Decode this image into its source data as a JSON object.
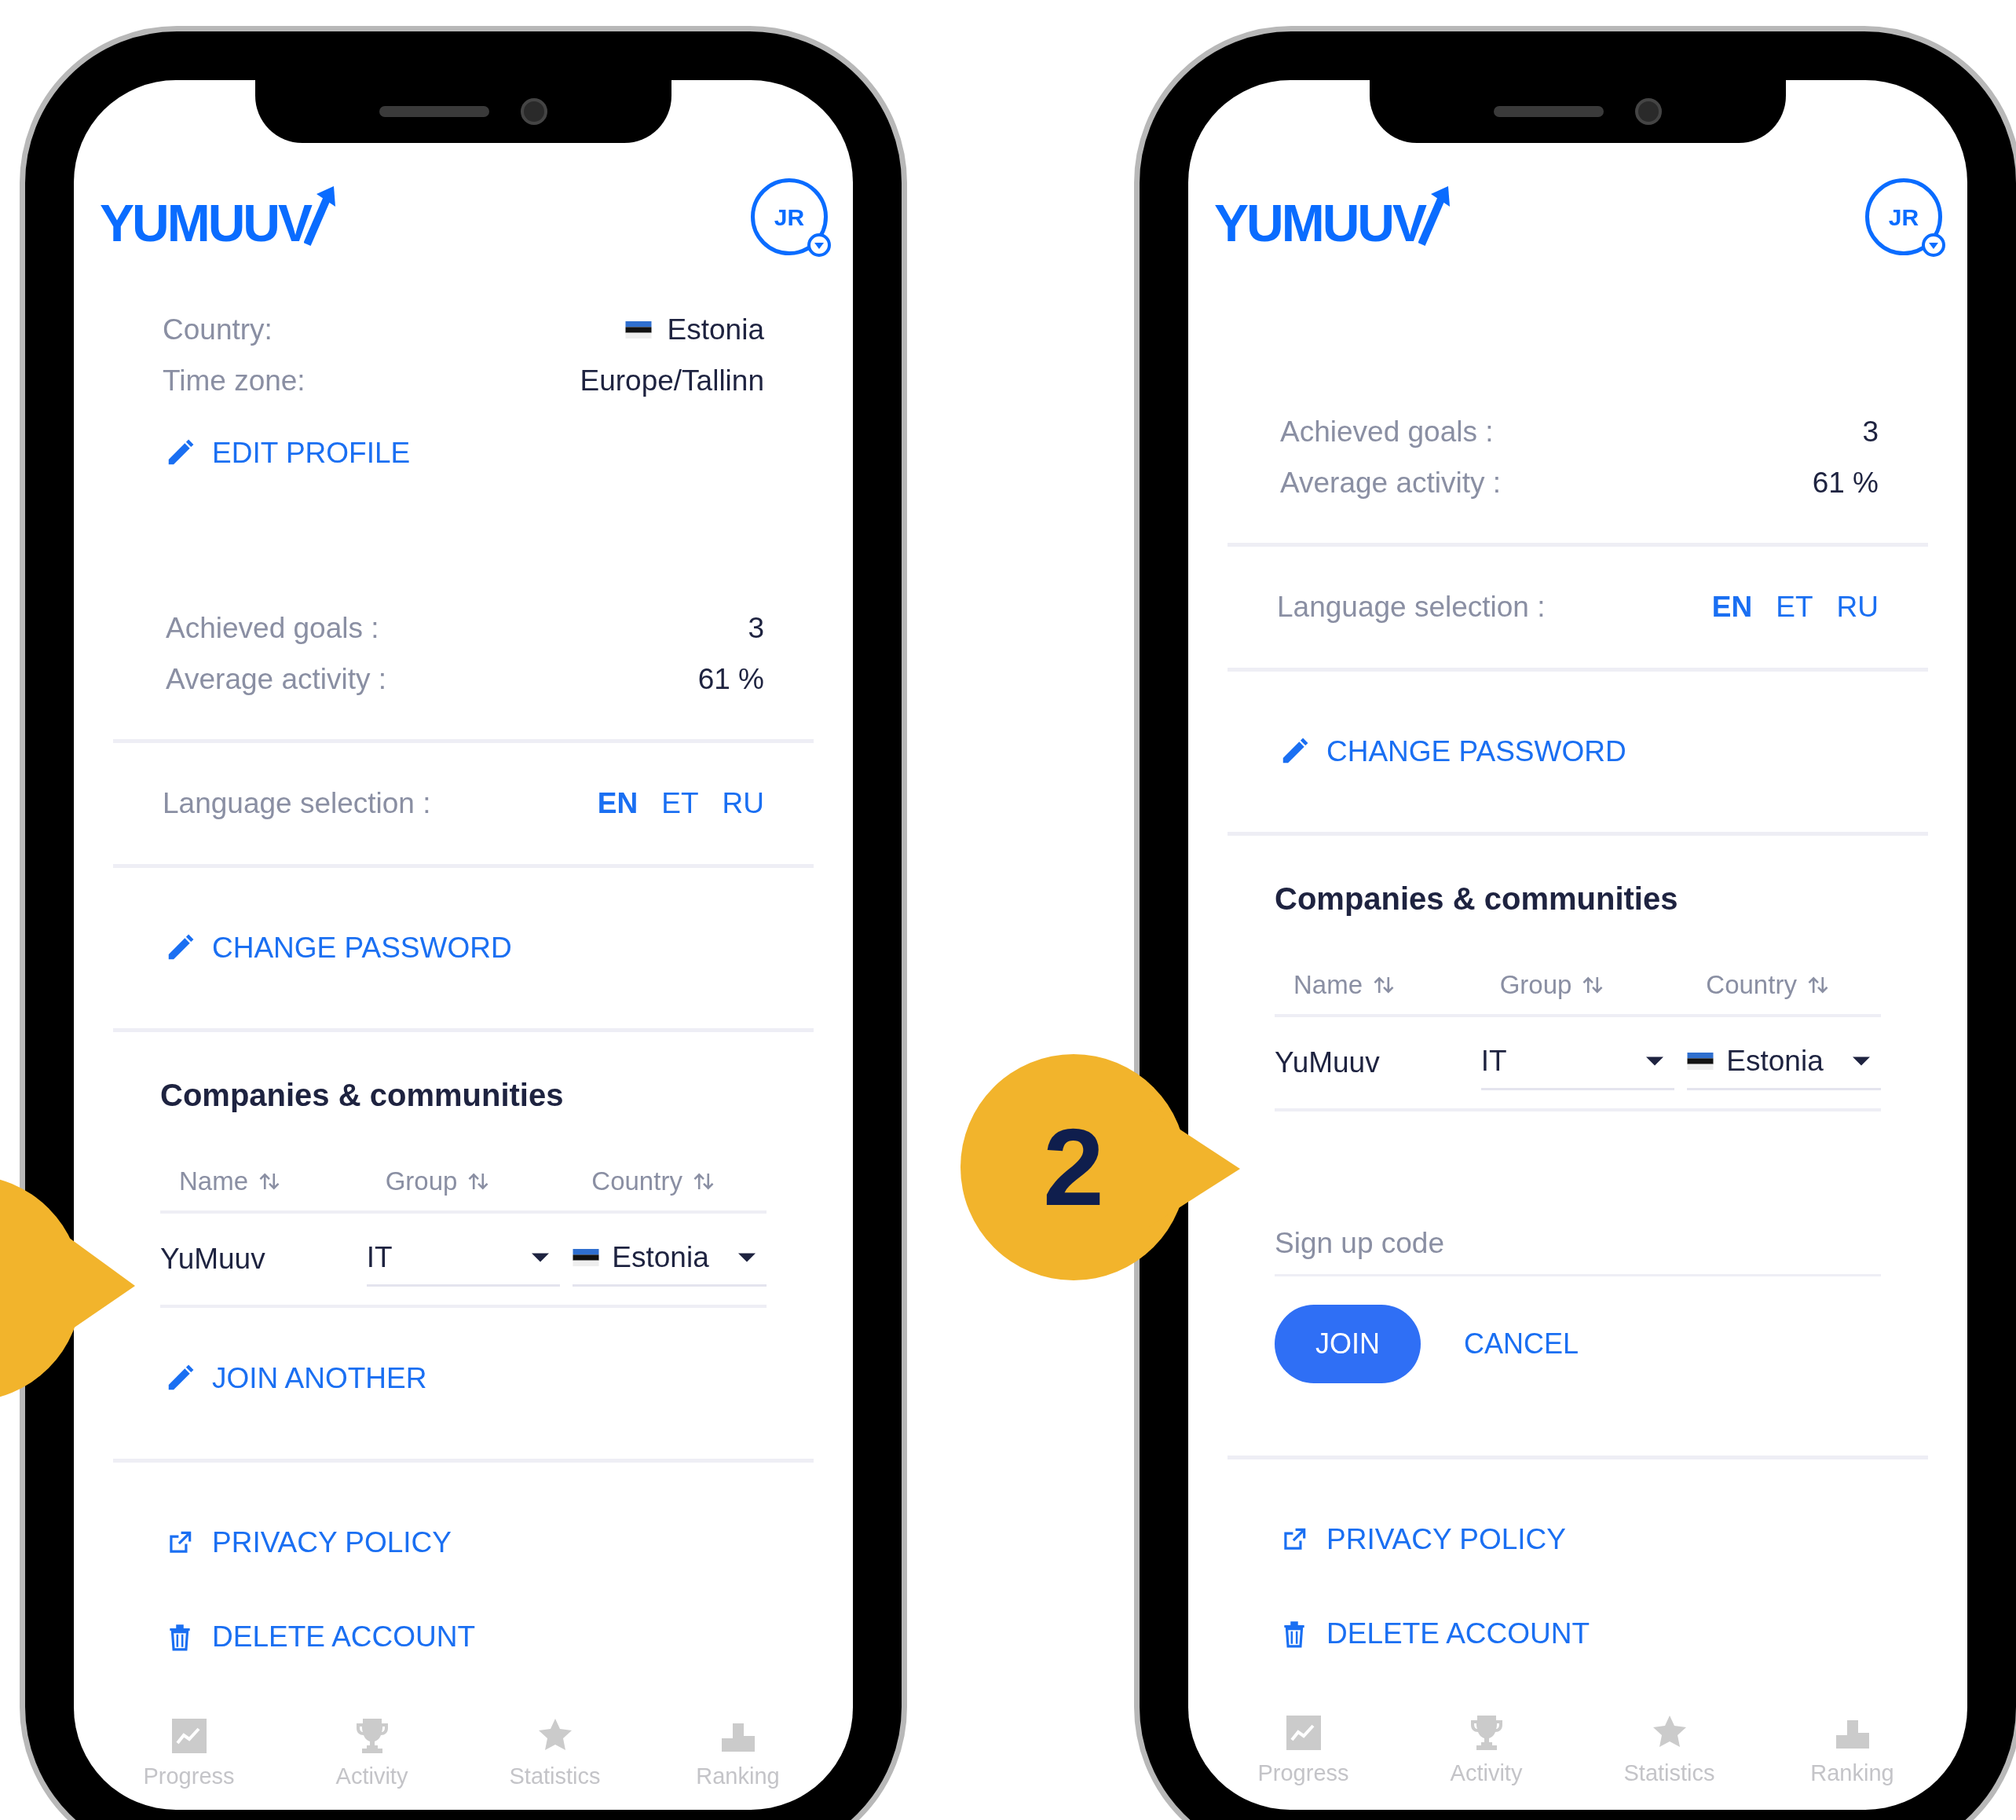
{
  "phones": [
    {
      "logo": "YUMUUV",
      "avatar": "JR",
      "groups": [
        [
          {
            "kind": "details",
            "rows": [
              {
                "label": "Country:",
                "value": "Estonia",
                "flag": true
              },
              {
                "label": "Time zone:",
                "value": "Europe/Tallinn",
                "flag": false
              }
            ]
          },
          {
            "kind": "edit",
            "label": "EDIT PROFILE"
          },
          {
            "kind": "stats",
            "rows": [
              {
                "label": "Achieved goals :",
                "value": "3"
              },
              {
                "label": "Average activity :",
                "value": "61 %"
              }
            ]
          }
        ],
        [
          {
            "kind": "language",
            "label": "Language selection :",
            "options": [
              {
                "label": "EN",
                "selected": true
              },
              {
                "label": "ET",
                "selected": false
              },
              {
                "label": "RU",
                "selected": false
              }
            ]
          }
        ],
        [
          {
            "kind": "edit",
            "label": "CHANGE PASSWORD"
          }
        ],
        [
          {
            "kind": "companies",
            "title": "Companies & communities",
            "columns": [
              "Name",
              "Group",
              "Country"
            ],
            "rows": [
              {
                "name": "YuMuuv",
                "group": "IT",
                "country": "Estonia"
              }
            ]
          },
          {
            "kind": "edit",
            "label": "JOIN ANOTHER"
          }
        ],
        [
          {
            "kind": "external",
            "label": "PRIVACY POLICY"
          },
          {
            "kind": "delete",
            "label": "DELETE ACCOUNT"
          }
        ]
      ],
      "nav": [
        {
          "kind": "progress",
          "label": "Progress"
        },
        {
          "kind": "activity",
          "label": "Activity"
        },
        {
          "kind": "statistics",
          "label": "Statistics"
        },
        {
          "kind": "ranking",
          "label": "Ranking"
        }
      ]
    },
    {
      "logo": "YUMUUV",
      "avatar": "JR",
      "groups": [
        [
          {
            "kind": "stats",
            "rows": [
              {
                "label": "Achieved goals :",
                "value": "3"
              },
              {
                "label": "Average activity :",
                "value": "61 %"
              }
            ]
          }
        ],
        [
          {
            "kind": "language",
            "label": "Language selection :",
            "options": [
              {
                "label": "EN",
                "selected": true
              },
              {
                "label": "ET",
                "selected": false
              },
              {
                "label": "RU",
                "selected": false
              }
            ]
          }
        ],
        [
          {
            "kind": "edit",
            "label": "CHANGE PASSWORD"
          }
        ],
        [
          {
            "kind": "companies",
            "title": "Companies & communities",
            "columns": [
              "Name",
              "Group",
              "Country"
            ],
            "rows": [
              {
                "name": "YuMuuv",
                "group": "IT",
                "country": "Estonia"
              }
            ]
          },
          {
            "kind": "signup",
            "placeholder": "Sign up code",
            "buttons": [
              {
                "kind": "primary",
                "label": "JOIN"
              },
              {
                "kind": "text",
                "label": "CANCEL"
              }
            ]
          }
        ],
        [
          {
            "kind": "external",
            "label": "PRIVACY POLICY"
          },
          {
            "kind": "delete",
            "label": "DELETE ACCOUNT"
          }
        ]
      ],
      "nav": [
        {
          "kind": "progress",
          "label": "Progress"
        },
        {
          "kind": "activity",
          "label": "Activity"
        },
        {
          "kind": "statistics",
          "label": "Statistics"
        },
        {
          "kind": "ranking",
          "label": "Ranking"
        }
      ]
    }
  ],
  "callouts": [
    {
      "number": "2"
    }
  ]
}
